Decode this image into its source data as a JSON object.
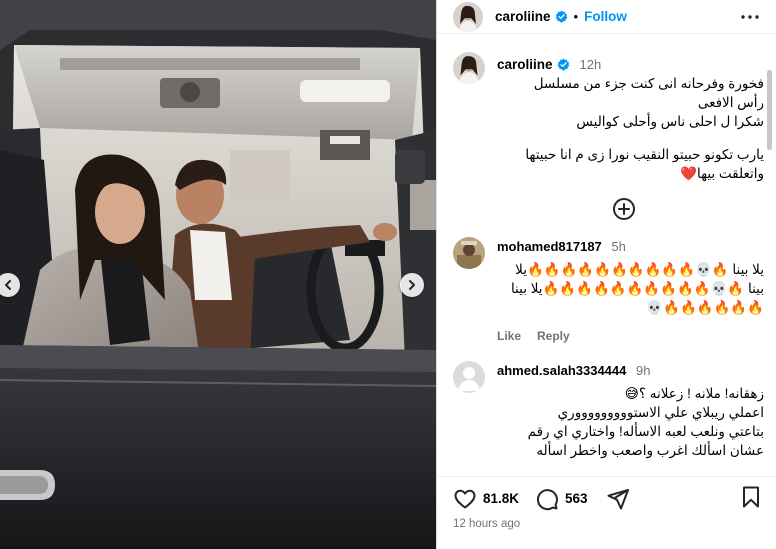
{
  "post": {
    "username": "caroliine",
    "follow_label": "Follow",
    "separator": "•",
    "posted_ago": "12 hours ago"
  },
  "caption": {
    "username": "caroliine",
    "time": "12h",
    "lines": [
      "فخورة وفرحانه انى كنت جزء من مسلسل",
      "رأس الافعى",
      "شكرا ل احلى ناس وأحلى كواليس",
      "",
      "يارب تكونو حبيتو النقيب نورا زى م انا حبيتها",
      "واتعلقت بيها❤️"
    ]
  },
  "comments": [
    {
      "username": "mohamed817187",
      "time": "5h",
      "text": "يلا بينا 🔥💀🔥🔥🔥🔥🔥🔥🔥🔥🔥🔥يلا بينا 🔥💀🔥🔥🔥🔥🔥🔥🔥🔥🔥🔥يلا بينا 🔥🔥🔥🔥🔥🔥💀",
      "like_label": "Like",
      "reply_label": "Reply"
    },
    {
      "username": "ahmed.salah3334444",
      "time": "9h",
      "lines": [
        "زهقانه! ملانه ! زعلانه ؟😅",
        "اعملي ريبلاي علي الاستوووووووووري",
        "بتاعتي ونلعب لعبه الاسأله! واختاري اي رقم",
        "عشان اسألك اغرب واصعب واخطر اسأله"
      ]
    }
  ],
  "stats": {
    "likes": "81.8K",
    "comments": "563"
  },
  "icons": {
    "verified": "verified-badge-icon",
    "more": "more-options-icon",
    "add": "add-comment-circle-icon",
    "like": "heart-icon",
    "comment": "comment-bubble-icon",
    "share": "send-icon",
    "save": "bookmark-icon",
    "prev": "chevron-left-icon",
    "next": "chevron-right-icon"
  },
  "colors": {
    "accent": "#0095f6",
    "muted": "#737373",
    "verified": "#0095f6"
  }
}
